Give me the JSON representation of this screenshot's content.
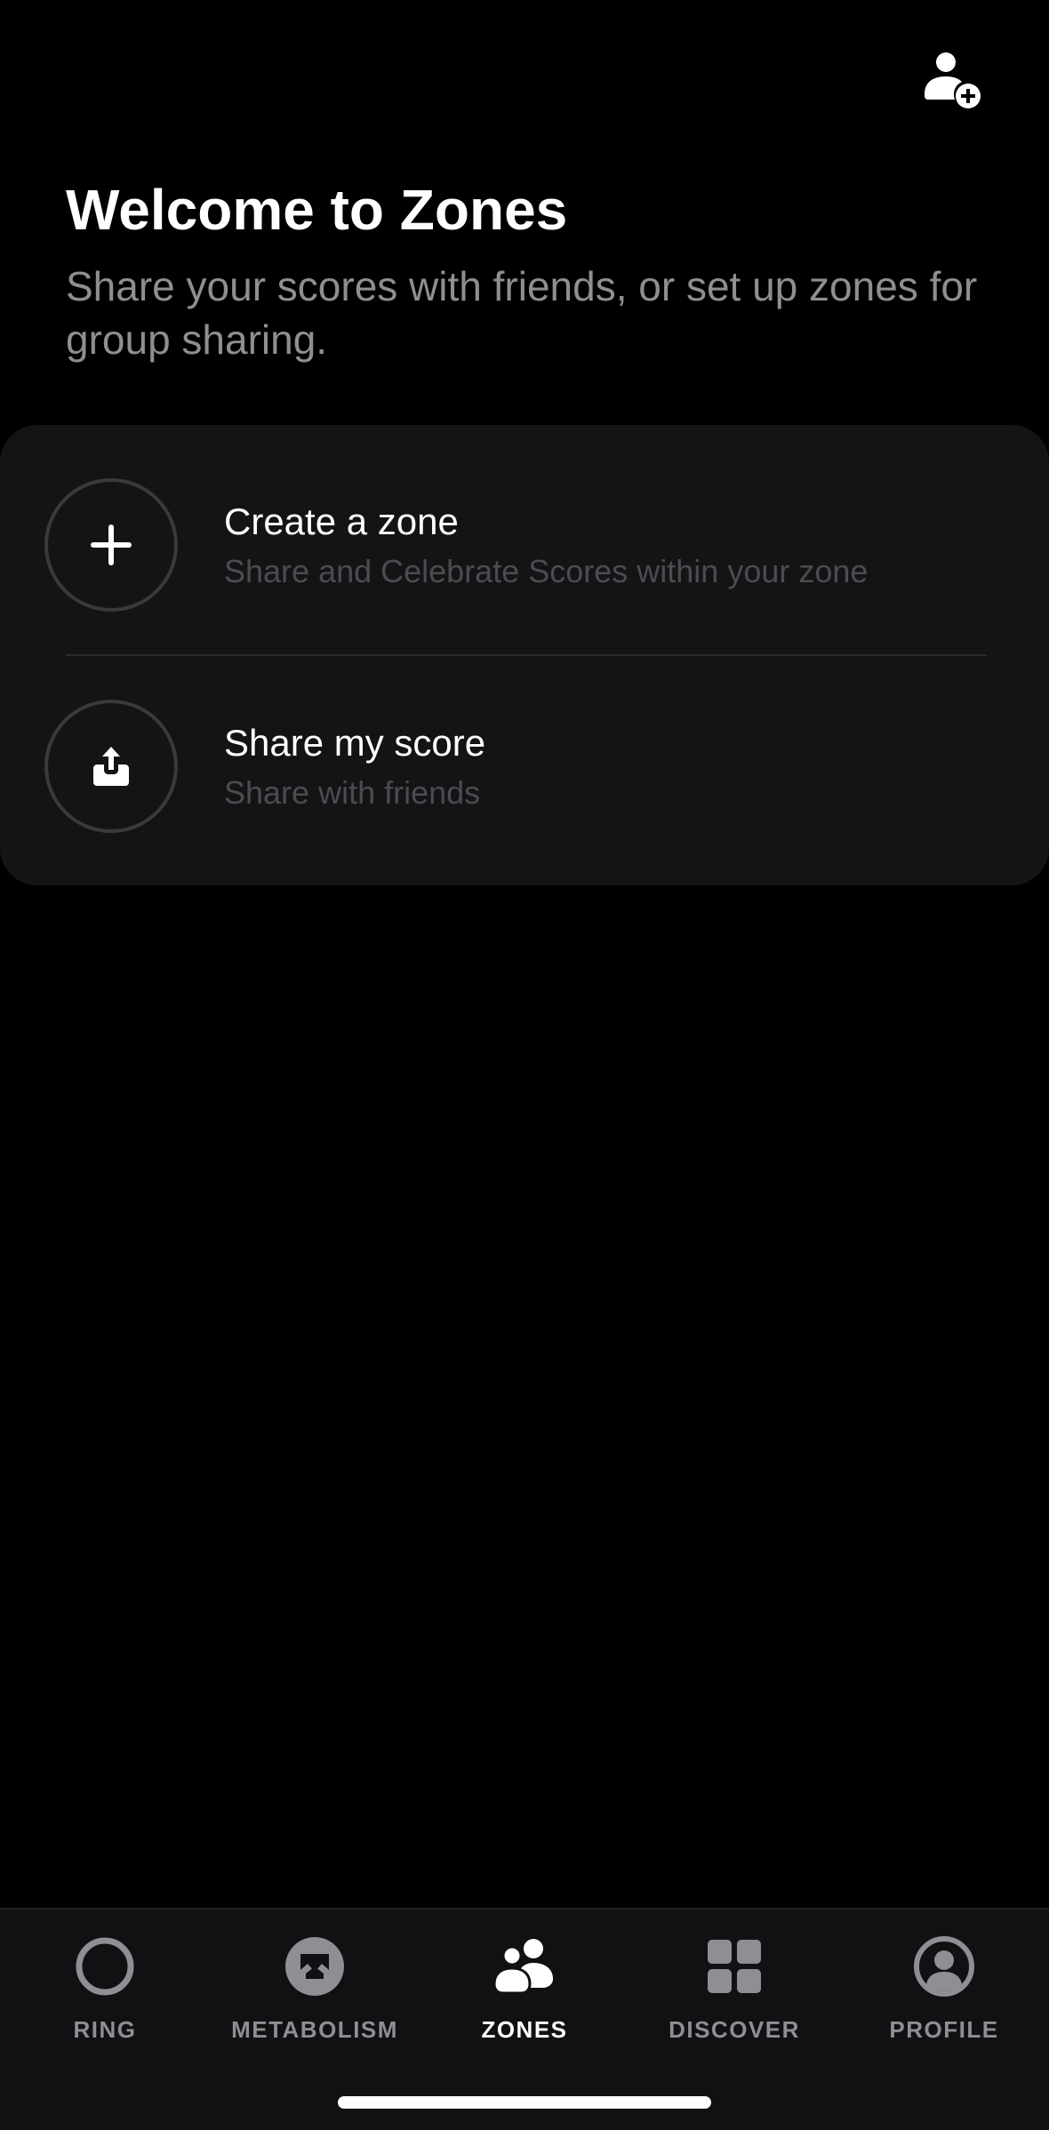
{
  "header": {
    "title": "Welcome to Zones",
    "subtitle": "Share your scores with friends, or set up zones for group sharing.",
    "add_friend_icon": "person-add-icon"
  },
  "card": {
    "items": [
      {
        "title": "Create a zone",
        "subtitle": "Share and Celebrate Scores within your zone",
        "icon": "plus-icon"
      },
      {
        "title": "Share my score",
        "subtitle": "Share with friends",
        "icon": "share-icon"
      }
    ]
  },
  "tabbar": {
    "tabs": [
      {
        "label": "RING",
        "icon": "ring-icon",
        "active": false
      },
      {
        "label": "METABOLISM",
        "icon": "metabolism-icon",
        "active": false
      },
      {
        "label": "ZONES",
        "icon": "zones-icon",
        "active": true
      },
      {
        "label": "DISCOVER",
        "icon": "grid-icon",
        "active": false
      },
      {
        "label": "PROFILE",
        "icon": "profile-icon",
        "active": false
      }
    ]
  },
  "colors": {
    "background": "#000000",
    "card": "#141416",
    "muted_text": "#8e8e93",
    "inactive_icon": "#8e8e93",
    "active": "#ffffff"
  }
}
